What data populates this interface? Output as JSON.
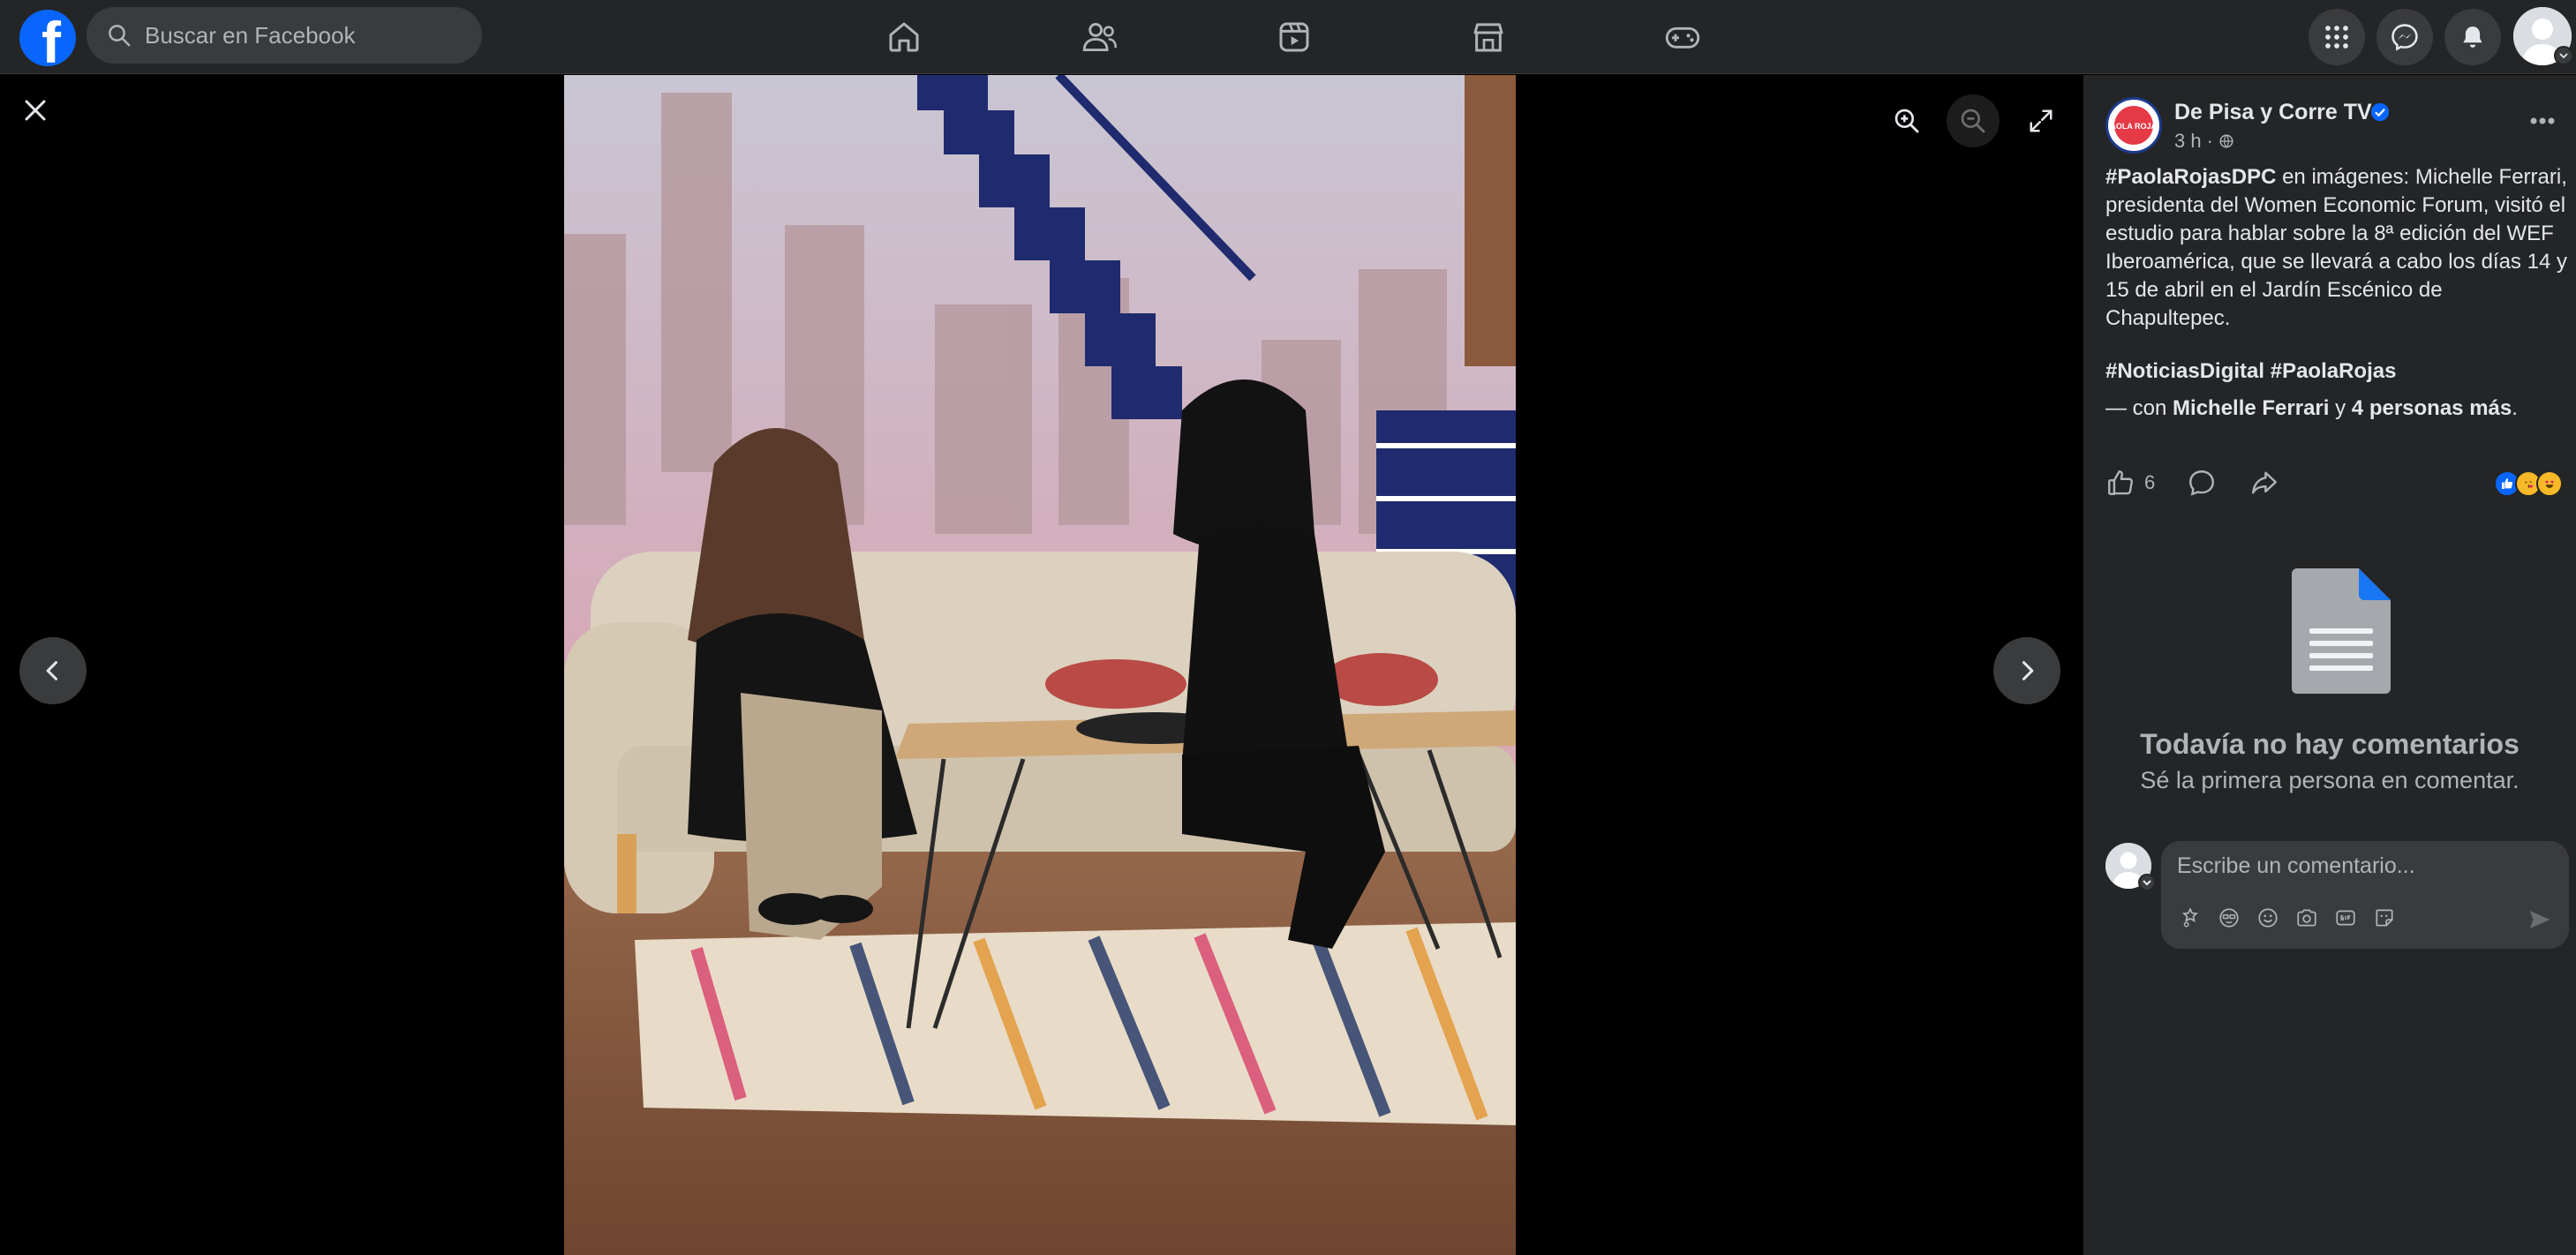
{
  "topbar": {
    "logo_letter": "f",
    "search_placeholder": "Buscar en Facebook",
    "nav_icons": [
      "home-icon",
      "friends-icon",
      "video-icon",
      "marketplace-icon",
      "gaming-icon"
    ],
    "right_icons": [
      "menu-grid-icon",
      "messenger-icon",
      "notifications-icon"
    ]
  },
  "viewer": {
    "tools": [
      "zoom-in-icon",
      "zoom-out-icon",
      "fullscreen-icon"
    ]
  },
  "post": {
    "page_name": "De Pisa y Corre TV",
    "avatar_text": "PAOLA ROJAS",
    "time": "3 h",
    "separator": "·",
    "text_hashtag": "#PaolaRojasDPC",
    "text_body": " en imágenes: Michelle Ferrari, presidenta del Women Economic Forum, visitó el estudio para hablar sobre la 8ª edición del WEF Iberoamérica, que se llevará a cabo los días 14 y 15 de abril en el Jardín Escénico de Chapultepec.",
    "tags": "#NoticiasDigital #PaolaRojas",
    "with_prefix": "— con ",
    "with_person": "Michelle Ferrari",
    "with_and": " y ",
    "with_others": "4 personas más",
    "with_end": ".",
    "like_count": "6"
  },
  "comments": {
    "empty_title": "Todavía no hay comentarios",
    "empty_subtitle": "Sé la primera persona en comentar.",
    "input_placeholder": "Escribe un comentario..."
  },
  "colors": {
    "accent": "#0866ff",
    "panel_bg": "#242526",
    "topbar_bg": "#242526",
    "control_bg": "#3a3b3c"
  }
}
